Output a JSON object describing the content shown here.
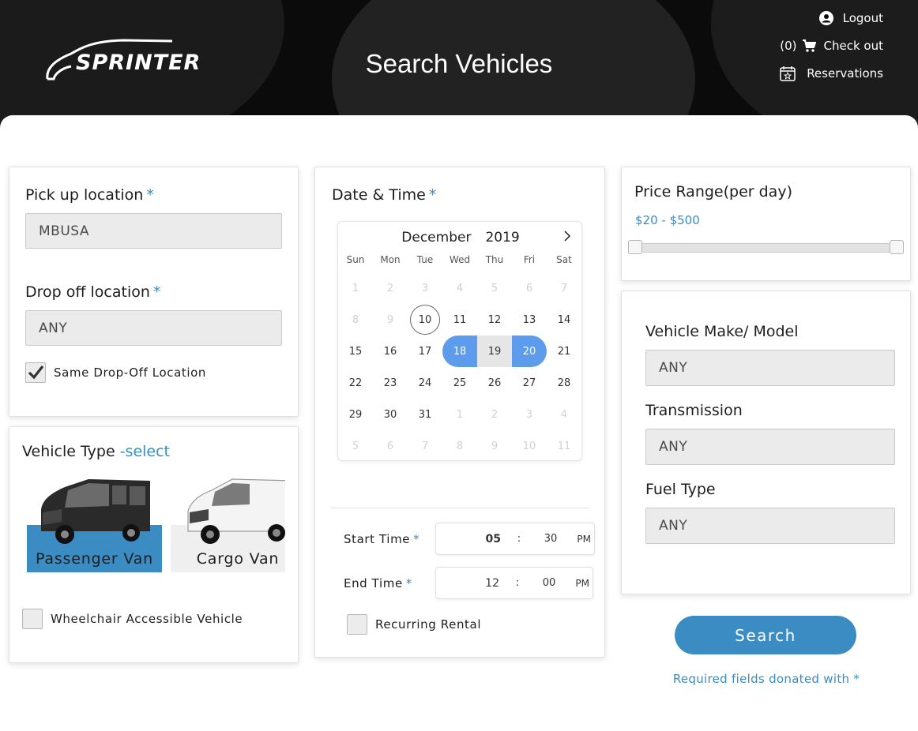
{
  "header": {
    "logo_text": "SPRINTER",
    "title": "Search Vehicles",
    "links": {
      "logout": "Logout",
      "cart_count": "(0)",
      "checkout": "Check out",
      "reservations": "Reservations"
    }
  },
  "pickup": {
    "label": "Pick up location",
    "required_mark": "*",
    "value": "MBUSA"
  },
  "dropoff": {
    "label": "Drop off location",
    "required_mark": "*",
    "value": "ANY",
    "same_location_label": "Same Drop-Off Location",
    "same_location_checked": true
  },
  "vehicle_type": {
    "label": "Vehicle Type",
    "select_hint": "-select",
    "options": [
      {
        "label": "Passenger Van",
        "selected": true
      },
      {
        "label": "Cargo Van",
        "selected": false
      }
    ],
    "wheelchair_label": "Wheelchair Accessible Vehicle"
  },
  "datetime": {
    "label": "Date & Time",
    "required_mark": "*",
    "calendar": {
      "month": "December",
      "year": "2019",
      "weekdays": [
        "Sun",
        "Mon",
        "Tue",
        "Wed",
        "Thu",
        "Fri",
        "Sat"
      ],
      "weeks": [
        [
          {
            "d": "1",
            "s": "muted"
          },
          {
            "d": "2",
            "s": "muted"
          },
          {
            "d": "3",
            "s": "muted"
          },
          {
            "d": "4",
            "s": "muted"
          },
          {
            "d": "5",
            "s": "muted"
          },
          {
            "d": "6",
            "s": "muted"
          },
          {
            "d": "7",
            "s": "muted"
          }
        ],
        [
          {
            "d": "8",
            "s": "muted"
          },
          {
            "d": "9",
            "s": "muted"
          },
          {
            "d": "10",
            "s": "today"
          },
          {
            "d": "11",
            "s": ""
          },
          {
            "d": "12",
            "s": ""
          },
          {
            "d": "13",
            "s": ""
          },
          {
            "d": "14",
            "s": ""
          }
        ],
        [
          {
            "d": "15",
            "s": ""
          },
          {
            "d": "16",
            "s": ""
          },
          {
            "d": "17",
            "s": ""
          },
          {
            "d": "18",
            "s": "start"
          },
          {
            "d": "19",
            "s": "range"
          },
          {
            "d": "20",
            "s": "end"
          },
          {
            "d": "21",
            "s": ""
          }
        ],
        [
          {
            "d": "22",
            "s": ""
          },
          {
            "d": "23",
            "s": ""
          },
          {
            "d": "24",
            "s": ""
          },
          {
            "d": "25",
            "s": ""
          },
          {
            "d": "26",
            "s": ""
          },
          {
            "d": "27",
            "s": ""
          },
          {
            "d": "28",
            "s": ""
          }
        ],
        [
          {
            "d": "29",
            "s": ""
          },
          {
            "d": "30",
            "s": ""
          },
          {
            "d": "31",
            "s": ""
          },
          {
            "d": "1",
            "s": "muted"
          },
          {
            "d": "2",
            "s": "muted"
          },
          {
            "d": "3",
            "s": "muted"
          },
          {
            "d": "4",
            "s": "muted"
          }
        ],
        [
          {
            "d": "5",
            "s": "muted"
          },
          {
            "d": "6",
            "s": "muted"
          },
          {
            "d": "7",
            "s": "muted"
          },
          {
            "d": "8",
            "s": "muted"
          },
          {
            "d": "9",
            "s": "muted"
          },
          {
            "d": "10",
            "s": "muted"
          },
          {
            "d": "11",
            "s": "muted"
          }
        ]
      ]
    },
    "start_time": {
      "label": "Start Time",
      "required_mark": "*",
      "hour": "05",
      "minute": "30",
      "ampm": "PM"
    },
    "end_time": {
      "label": "End Time",
      "required_mark": "*",
      "hour": "12",
      "minute": "00",
      "ampm": "PM"
    },
    "time_separator": ":",
    "recurring_label": "Recurring Rental"
  },
  "price": {
    "label": "Price Range(per day)",
    "range_text": "$20 - $500"
  },
  "filters": {
    "make_label": "Vehicle Make/ Model",
    "make_value": "ANY",
    "transmission_label": "Transmission",
    "transmission_value": "ANY",
    "fuel_label": "Fuel Type",
    "fuel_value": "ANY"
  },
  "search_button": "Search",
  "footnote": "Required fields donated with *",
  "colors": {
    "accent": "#3a8cc2",
    "calendar_selected": "#5d9cec",
    "header_bg": "#0b0b0b"
  }
}
